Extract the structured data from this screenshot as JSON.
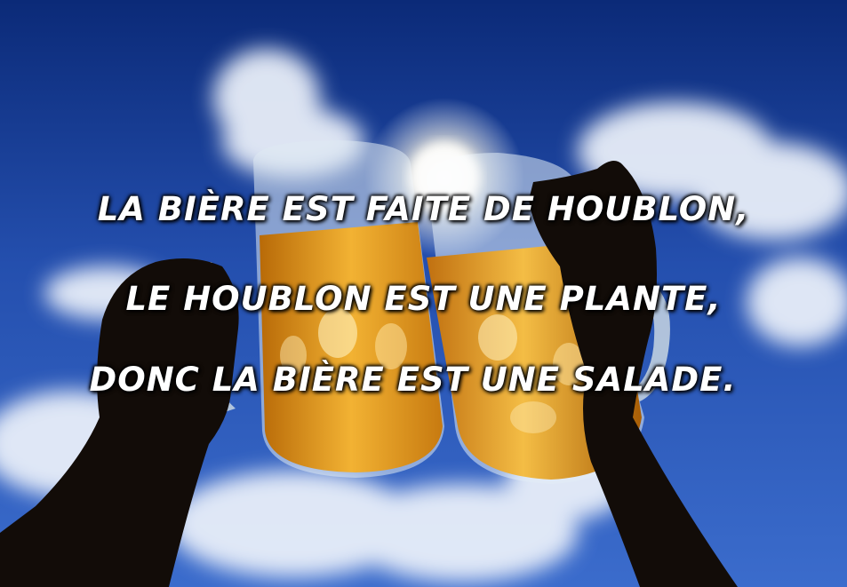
{
  "caption": {
    "line1": "LA BIÈRE EST FAITE DE HOUBLON,",
    "line2": "LE HOUBLON EST UNE PLANTE,",
    "line3": "DONC LA BIÈRE EST UNE SALADE."
  },
  "colors": {
    "sky_top": "#0b2a78",
    "sky_mid": "#2a56b8",
    "beer": "#e39a1c",
    "glass": "#d8e6f2",
    "silhouette": "#120c08",
    "text": "#ffffff"
  }
}
